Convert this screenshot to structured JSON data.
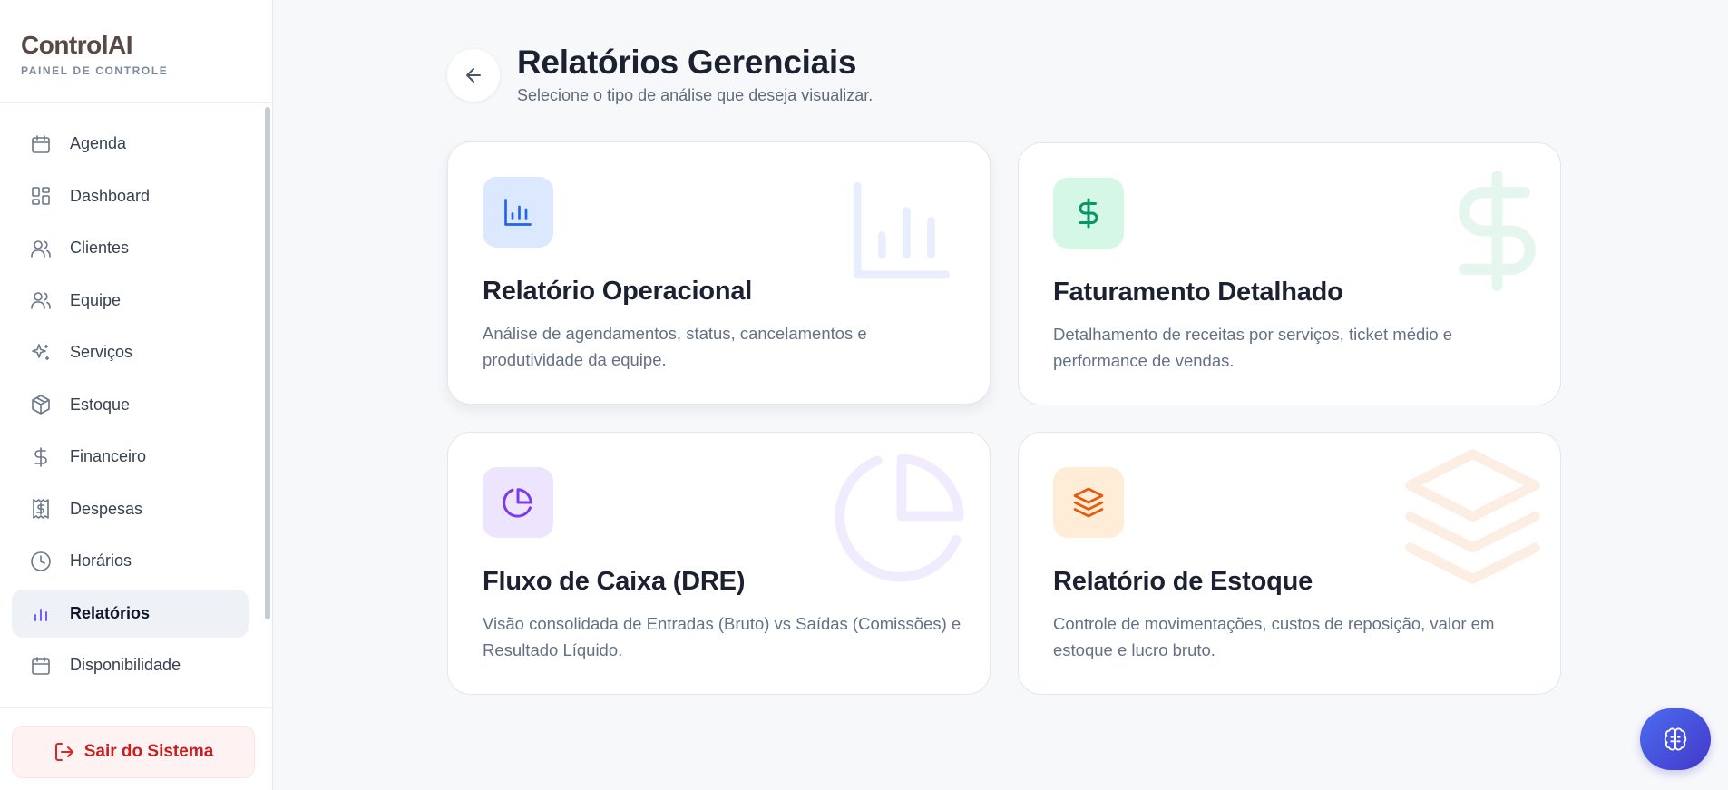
{
  "brand": {
    "name": "ControlAI",
    "subtitle": "PAINEL DE CONTROLE"
  },
  "sidebar": {
    "items": [
      {
        "label": "Agenda",
        "icon": "calendar-icon"
      },
      {
        "label": "Dashboard",
        "icon": "grid-icon"
      },
      {
        "label": "Clientes",
        "icon": "users-icon"
      },
      {
        "label": "Equipe",
        "icon": "users-icon"
      },
      {
        "label": "Serviços",
        "icon": "sparkles-icon"
      },
      {
        "label": "Estoque",
        "icon": "package-icon"
      },
      {
        "label": "Financeiro",
        "icon": "dollar-icon"
      },
      {
        "label": "Despesas",
        "icon": "receipt-icon"
      },
      {
        "label": "Horários",
        "icon": "clock-icon"
      },
      {
        "label": "Relatórios",
        "icon": "bar-chart-icon",
        "active": true
      },
      {
        "label": "Disponibilidade",
        "icon": "calendar-icon"
      }
    ],
    "logout_label": "Sair do Sistema"
  },
  "header": {
    "title": "Relatórios Gerenciais",
    "subtitle": "Selecione o tipo de análise que deseja visualizar."
  },
  "cards": [
    {
      "title": "Relatório Operacional",
      "description": "Análise de agendamentos, status, cancelamentos e produtividade da equipe.",
      "icon": "bar-chart-icon",
      "accent": "#2563eb",
      "tint": "#dbe8fd"
    },
    {
      "title": "Faturamento Detalhado",
      "description": "Detalhamento de receitas por serviços, ticket médio e performance de vendas.",
      "icon": "dollar-icon",
      "accent": "#059669",
      "tint": "#d5f7e6"
    },
    {
      "title": "Fluxo de Caixa (DRE)",
      "description": "Visão consolidada de Entradas (Bruto) vs Saídas (Comissões) e Resultado Líquido.",
      "icon": "pie-chart-icon",
      "accent": "#7c3aed",
      "tint": "#ede5fd"
    },
    {
      "title": "Relatório de Estoque",
      "description": "Controle de movimentações, custos de reposição, valor em estoque e lucro bruto.",
      "icon": "layers-icon",
      "accent": "#ea580c",
      "tint": "#ffedd8"
    }
  ],
  "colors": {
    "active_icon": "#7a5af8",
    "logout": "#c81e1e",
    "fab": "#4b6cf0"
  }
}
